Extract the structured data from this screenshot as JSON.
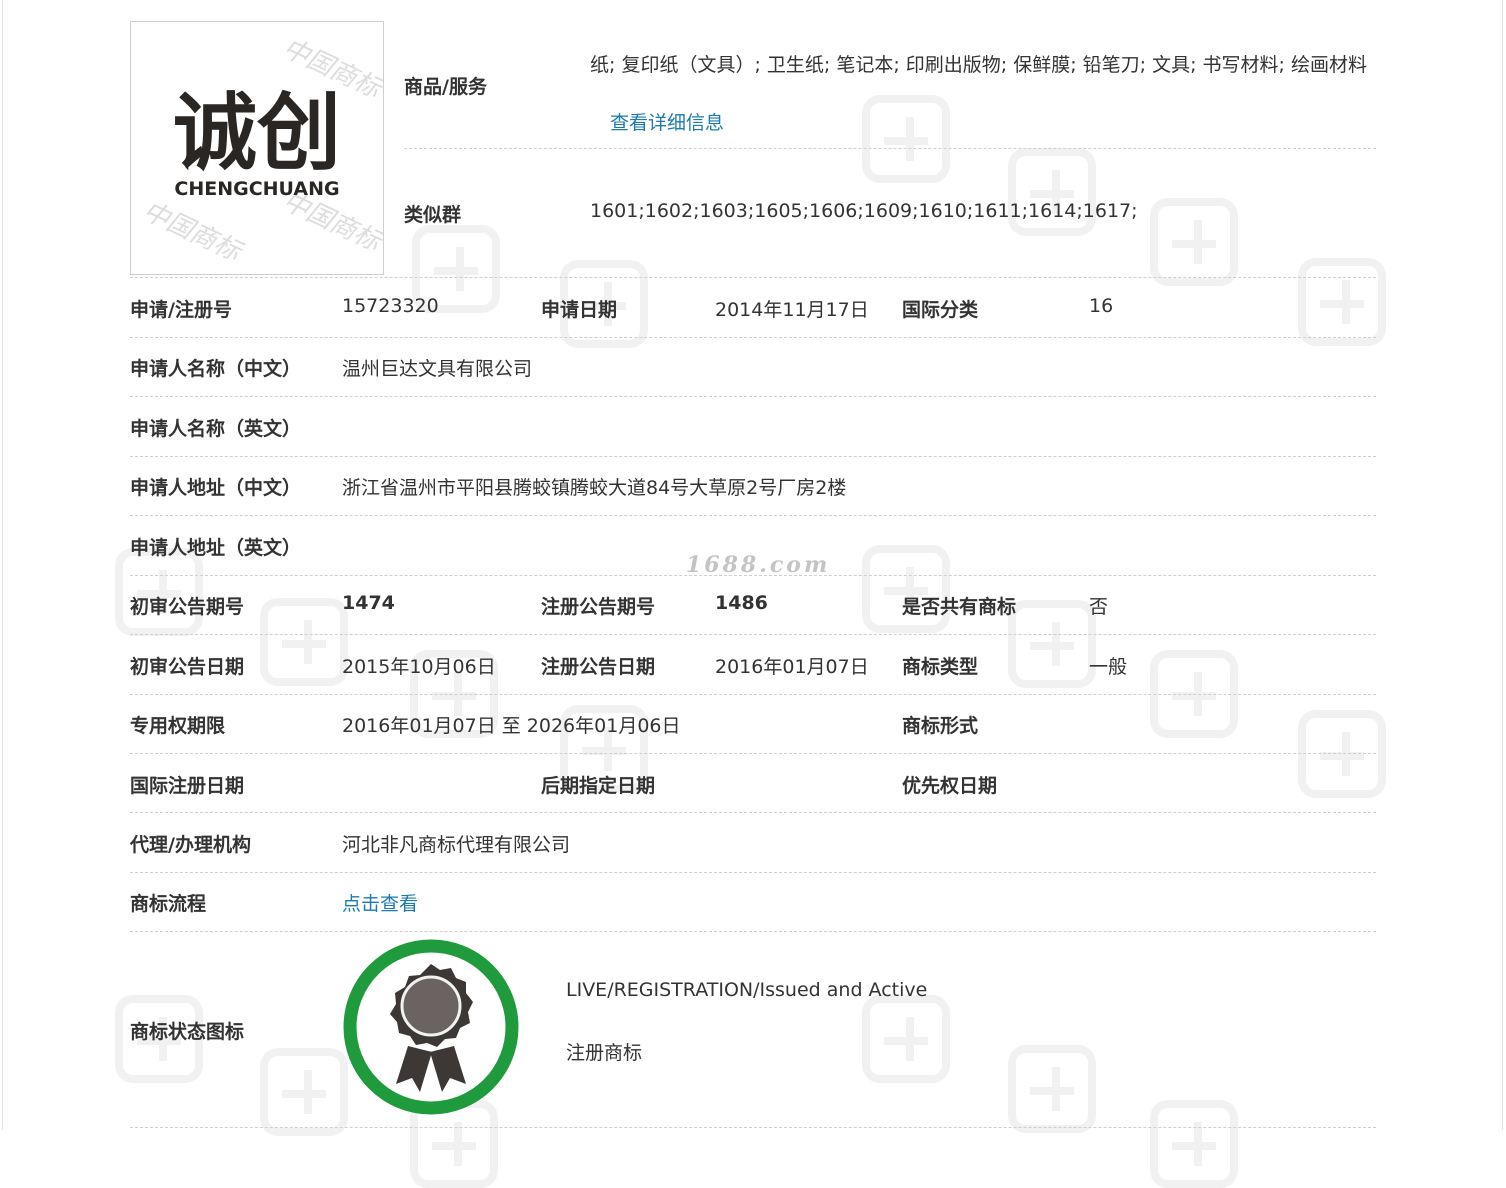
{
  "logo": {
    "chinese_text": "诚创",
    "english_text": "CHENGCHUANG",
    "watermark_text": "中国商标"
  },
  "watermark": {
    "site": "1688.com"
  },
  "goods": {
    "label": "商品/服务",
    "text": "纸; 复印纸（文具）; 卫生纸; 笔记本; 印刷出版物; 保鲜膜; 铅笔刀; 文具; 书写材料; 绘画材料",
    "detail_link": "查看详细信息"
  },
  "similar_group": {
    "label": "类似群",
    "value": "1601;1602;1603;1605;1606;1609;1610;1611;1614;1617;"
  },
  "rows": {
    "reg_no": {
      "label": "申请/注册号",
      "value": "15723320"
    },
    "apply_date": {
      "label": "申请日期",
      "value": "2014年11月17日"
    },
    "intl_class": {
      "label": "国际分类",
      "value": "16"
    },
    "applicant_cn": {
      "label": "申请人名称（中文）",
      "value": "温州巨达文具有限公司"
    },
    "applicant_en": {
      "label": "申请人名称（英文）",
      "value": ""
    },
    "address_cn": {
      "label": "申请人地址（中文）",
      "value": "浙江省温州市平阳县腾蛟镇腾蛟大道84号大草原2号厂房2楼"
    },
    "address_en": {
      "label": "申请人地址（英文）",
      "value": ""
    },
    "prelim_pub_no": {
      "label": "初审公告期号",
      "value": "1474"
    },
    "reg_pub_no": {
      "label": "注册公告期号",
      "value": "1486"
    },
    "shared_mark": {
      "label": "是否共有商标",
      "value": "否"
    },
    "prelim_pub_date": {
      "label": "初审公告日期",
      "value": "2015年10月06日"
    },
    "reg_pub_date": {
      "label": "注册公告日期",
      "value": "2016年01月07日"
    },
    "mark_type": {
      "label": "商标类型",
      "value": "一般"
    },
    "exclusive_period": {
      "label": "专用权期限",
      "value": "2016年01月07日 至 2026年01月06日"
    },
    "mark_form": {
      "label": "商标形式",
      "value": ""
    },
    "intl_reg_date": {
      "label": "国际注册日期",
      "value": ""
    },
    "later_designation_date": {
      "label": "后期指定日期",
      "value": ""
    },
    "priority_date": {
      "label": "优先权日期",
      "value": ""
    },
    "agency": {
      "label": "代理/办理机构",
      "value": "河北非凡商标代理有限公司"
    },
    "process": {
      "label": "商标流程",
      "value": "点击查看"
    }
  },
  "status": {
    "label": "商标状态图标",
    "status_en": "LIVE/REGISTRATION/Issued and Active",
    "status_cn": "注册商标",
    "icon": "award-ribbon-icon",
    "ring_color": "#1f9a3c"
  }
}
